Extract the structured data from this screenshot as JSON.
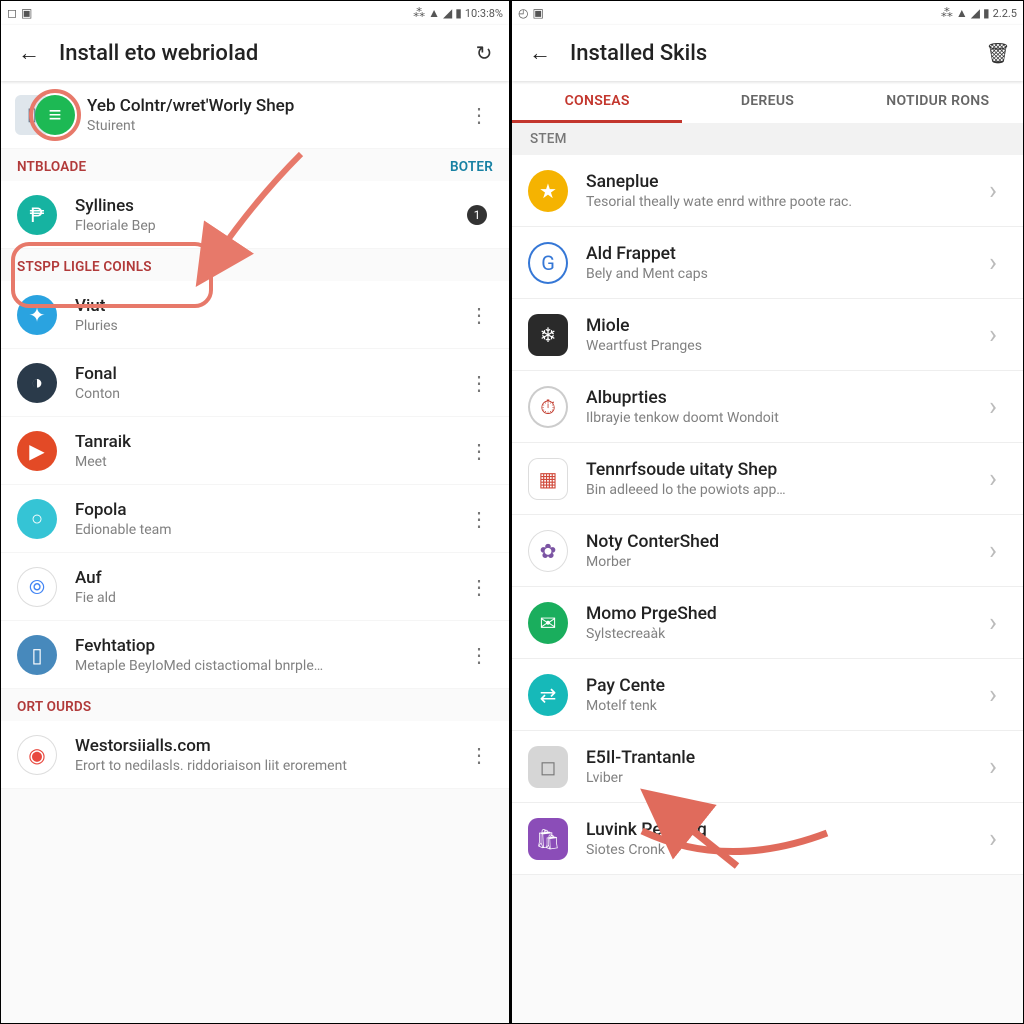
{
  "left": {
    "statusbar": {
      "time": "10:3:8%",
      "battery": ""
    },
    "appbar": {
      "title": "Install eto webrioIad",
      "back_label": "←",
      "action_label": "↻"
    },
    "featured": {
      "title": "Yeb Colntr/wret'Worly Shep",
      "subtitle": "Stuirent",
      "icon_color": "#1db954"
    },
    "sections": [
      {
        "header": "NTBLOADE",
        "header_link": "BOTER",
        "items": [
          {
            "title": "Syllines",
            "subtitle": "Fleoriale Bep",
            "icon_color": "#16b3a1",
            "badge": "1",
            "glyph": "₱"
          }
        ]
      },
      {
        "header": "STSPP LIGLE COINLS",
        "items": [
          {
            "title": "Viut",
            "subtitle": "Pluries",
            "icon_color": "#2aa3e0",
            "glyph": "✦"
          },
          {
            "title": "Fonal",
            "subtitle": "Conton",
            "icon_color": "#2a3a4a",
            "glyph": "◑"
          },
          {
            "title": "Tanraik",
            "subtitle": "Meet",
            "icon_color": "#e34a26",
            "glyph": "▶"
          },
          {
            "title": "Fopola",
            "subtitle": "Edionable team",
            "icon_color": "#35c4d5",
            "glyph": "○"
          },
          {
            "title": "Auf",
            "subtitle": "Fie ald",
            "icon_color": "#ffffff",
            "glyph": "⦾",
            "text_color": "#4285f4"
          },
          {
            "title": "Fevhtatiop",
            "subtitle": "Metaple BeyIoMed cistactiomal bnrple…",
            "icon_color": "#4789bc",
            "glyph": "▯"
          }
        ]
      },
      {
        "header": "ORT OURDS",
        "items": [
          {
            "title": "Westorsiialls.com",
            "subtitle": "Erort to nedilasls. riddoriaison liit erorement",
            "icon_color": "#ffffff",
            "glyph": "◉",
            "text_color": "#e8483e"
          }
        ]
      }
    ]
  },
  "right": {
    "statusbar": {
      "time": "2.2.5"
    },
    "appbar": {
      "title": "Installed Skils",
      "back_label": "←",
      "action_label": "🗑"
    },
    "tabs": [
      {
        "label": "CONSEAS",
        "active": true
      },
      {
        "label": "DEREUS"
      },
      {
        "label": "NOTIDUR RONS"
      }
    ],
    "band": "STEM",
    "items": [
      {
        "title": "Saneplue",
        "subtitle": "Tesorial theally wate enrd withre poote rac.",
        "icon_color": "#f5b301",
        "glyph": "★"
      },
      {
        "title": "Ald Frappet",
        "subtitle": "Bely and Ment caps",
        "icon_color": "#ffffff",
        "glyph": "G",
        "ring": "#3577d6",
        "text_color": "#3577d6"
      },
      {
        "title": "Miole",
        "subtitle": "Weartfust Pranges",
        "icon_color": "#2a2a2a",
        "glyph": "❄",
        "square": true
      },
      {
        "title": "Albuprties",
        "subtitle": "Ilbrayie tenkow doomt Wondoit",
        "icon_color": "#ffffff",
        "glyph": "⏱",
        "ring": "#ccc",
        "text_color": "#c1392b"
      },
      {
        "title": "Tennrfsoude uitaty Shep",
        "subtitle": "Bin adleeed lo the powiots app…",
        "icon_color": "#ffffff",
        "glyph": "▦",
        "square": true,
        "text_color": "#d0493a"
      },
      {
        "title": "Noty ConterShed",
        "subtitle": "Morber",
        "icon_color": "#ffffff",
        "glyph": "✿",
        "text_color": "#7b54a3"
      },
      {
        "title": "Momo PrgeShed",
        "subtitle": "Sylstecreaàk",
        "icon_color": "#1aae5d",
        "glyph": "✉"
      },
      {
        "title": "Pay Cente",
        "subtitle": "Motelf tenk",
        "icon_color": "#16b9b9",
        "glyph": "⇄"
      },
      {
        "title": "E5Il-Trantanle",
        "subtitle": "Lviber",
        "icon_color": "#d6d6d6",
        "glyph": "◻",
        "square": true,
        "text_color": "#777"
      },
      {
        "title": "Luvink Perliting",
        "subtitle": "Siotes Cronk",
        "icon_color": "#8b4db8",
        "glyph": "🛍",
        "square": true
      }
    ]
  }
}
